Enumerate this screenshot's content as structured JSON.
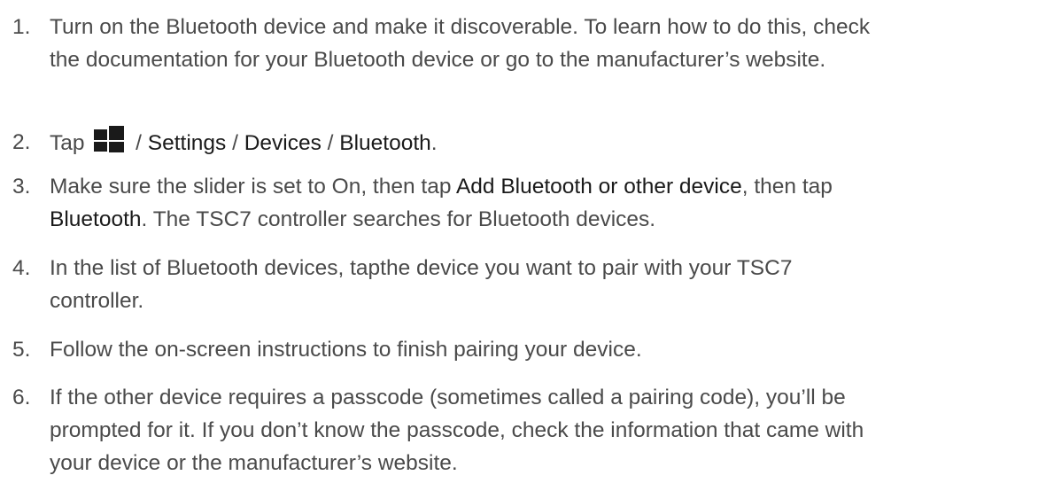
{
  "steps": [
    {
      "number": "1.",
      "lines": [
        "Turn on the Bluetooth device and make it discoverable. To learn how to do this, check",
        "the documentation for your Bluetooth device or go to the manufacturer’s website."
      ]
    },
    {
      "number": "2.",
      "prefix": "Tap",
      "icon": "windows-icon",
      "path": [
        "Settings",
        "Devices",
        "Bluetooth"
      ],
      "separator": " / ",
      "suffix": "."
    },
    {
      "number": "3.",
      "part1": "Make sure the slider is set to On, then tap ",
      "ui1": "Add Bluetooth or other device",
      "part2": ", then tap",
      "ui2": "Bluetooth",
      "part3": ". The TSC7 controller searches for Bluetooth devices."
    },
    {
      "number": "4.",
      "lines": [
        "In the list of Bluetooth devices, tapthe device you want to pair with your TSC7",
        "controller."
      ]
    },
    {
      "number": "5.",
      "lines": [
        "Follow the on-screen instructions to finish pairing your device."
      ]
    },
    {
      "number": "6.",
      "lines": [
        "If the other device requires a passcode (sometimes called a pairing code), you’ll be",
        "prompted for it. If you don’t know the passcode, check the information that came with",
        "your device or the manufacturer’s website."
      ]
    }
  ]
}
